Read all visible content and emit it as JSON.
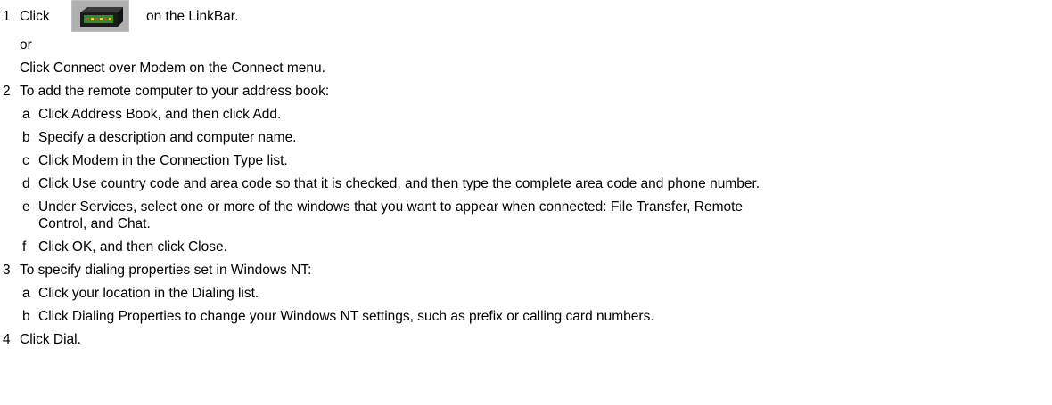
{
  "steps": [
    {
      "num": "1",
      "text_before_icon": "Click",
      "icon": "modem-icon",
      "text_after_icon": "on the LinkBar.",
      "or_label": "or",
      "alt_text": "Click Connect over Modem on the Connect menu."
    },
    {
      "num": "2",
      "text": "To add the remote computer to your address book:",
      "substeps": [
        {
          "letter": "a",
          "text": "Click Address Book, and then click Add."
        },
        {
          "letter": "b",
          "text": "Specify a description and computer name."
        },
        {
          "letter": "c",
          "text": "Click Modem in the Connection Type list."
        },
        {
          "letter": "d",
          "text": "Click Use country code and area code so that it is checked, and then type the complete area code and phone number."
        },
        {
          "letter": "e",
          "text": "Under Services, select one or more of the windows that you want to appear when connected: File Transfer, Remote",
          "continuation": "Control, and Chat."
        },
        {
          "letter": "f",
          "text": "Click OK, and then click Close."
        }
      ]
    },
    {
      "num": "3",
      "text": "To specify dialing properties set in Windows NT:",
      "substeps": [
        {
          "letter": "a",
          "text": "Click your location in the Dialing list."
        },
        {
          "letter": "b",
          "text": "Click Dialing Properties to change your Windows NT settings, such as prefix or calling card numbers."
        }
      ]
    },
    {
      "num": "4",
      "text": "Click Dial."
    }
  ],
  "colors": {
    "text": "#000000",
    "background": "#ffffff",
    "icon_body": "#1a1a1a",
    "icon_panel": "#2e8b2e",
    "icon_backdrop": "#b8b8b8"
  }
}
